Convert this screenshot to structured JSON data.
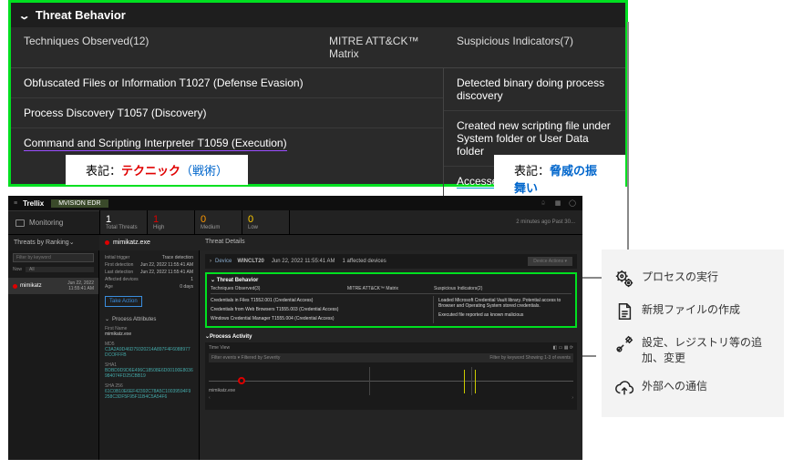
{
  "top_box": {
    "title": "Threat Behavior",
    "cols": {
      "c1": "Techniques Observed(12)",
      "c2": "MITRE ATT&CK™ Matrix",
      "c3": "Suspicious Indicators(7)"
    },
    "left": [
      "Obfuscated Files or Information T1027 (Defense Evasion)",
      "Process Discovery T1057 (Discovery)",
      "Command and Scripting Interpreter T1059 (Execution)"
    ],
    "right": [
      "Detected binary doing process discovery",
      "Created new scripting file under System folder or User Data folder",
      "Accessed uncommon network port"
    ],
    "tag1_pre": "表記：",
    "tag1_a": "テクニック",
    "tag1_b": "（戦術）",
    "tag2_pre": "表記：",
    "tag2_a": "脅威の振舞い"
  },
  "app": {
    "brand": "Trellix",
    "mission": "MVISION EDR",
    "monitoring": "Monitoring",
    "stats": {
      "tot_n": "1",
      "tot_l": "Total Threats",
      "hi_n": "1",
      "hi_l": "High",
      "med_n": "0",
      "med_l": "Medium",
      "lo_n": "0",
      "lo_l": "Low",
      "time": "2 minutes ago    Past 30..."
    },
    "r3": {
      "a": "Threats by Ranking⌄",
      "b": "mimikatz.exe",
      "c": "Threat Details"
    },
    "colA": {
      "filter_ph": "Filter by keyword",
      "now": "Now",
      "now_sel": "All",
      "item_name": "mimikatz",
      "item_date": "Jun 22, 2022",
      "item_time": "11:55:41 AM"
    },
    "colB": {
      "k1": "Initial trigger",
      "v1": "Trace detection",
      "k2": "First detection",
      "v2": "Jun 22, 2022 11:55:41 AM",
      "k3": "Last detection",
      "v3": "Jun 22, 2022 11:55:41 AM",
      "k4": "Affected devices",
      "v4": "1",
      "k5": "Age",
      "v5": "0 days",
      "take": "Take Action",
      "pattr": "Process Attributes",
      "l_name": "First Name",
      "v_name": "mimikatz.exe",
      "l_md5": "MD5",
      "v_md5": "C3A2A9D46D79320214A897F4F6088977DCOFFFB",
      "l_sha1": "SHA1",
      "v_sha1": "BDBD9D9D6E496C18508E6D00100E8036984074FD25CBB19",
      "l_sha256": "SHA 256",
      "v_sha256": "61C0B10E6EF42392C78A5C10039594F9258C3DF5F95F11B4C5A54F6"
    },
    "colC": {
      "dev_lab": "Device",
      "dev_host": "WINCLT20",
      "dev_time": "Jun 22, 2022 11:55:41 AM",
      "dev_aff": "1 affected devices",
      "dev_btn": "Device Actions  ▾",
      "gb_title": "Threat Behavior",
      "gb_c1": "Techniques Observed(3)",
      "gb_c2": "MITRE ATT&CK™ Matrix",
      "gb_c3": "Suspicious Indicators(2)",
      "gb_l1": "Credentials in Files T1552.001 (Credential Access)",
      "gb_l2": "Credentials from Web Browsers T1555.003 (Credential Access)",
      "gb_l3": "Windows Credential Manager T1555.004 (Credential Access)",
      "gb_r1": "Loaded Microsoft Credential Vault library. Potential access to Browser and Operating System stored credentials.",
      "gb_r2": "Executed file reported as known malicious",
      "pact": "Process Activity",
      "tl_title": "Time View",
      "tl_filter": "Filter events ▾    Filtered by Severity",
      "tl_right": "Filter by keyword     Showing 1-3 of events",
      "tl_label": "mimikatz.exe"
    }
  },
  "legend": {
    "r1": "プロセスの実行",
    "r2": "新規ファイルの作成",
    "r3": "設定、レジストリ等の追加、変更",
    "r4": "外部への通信"
  }
}
